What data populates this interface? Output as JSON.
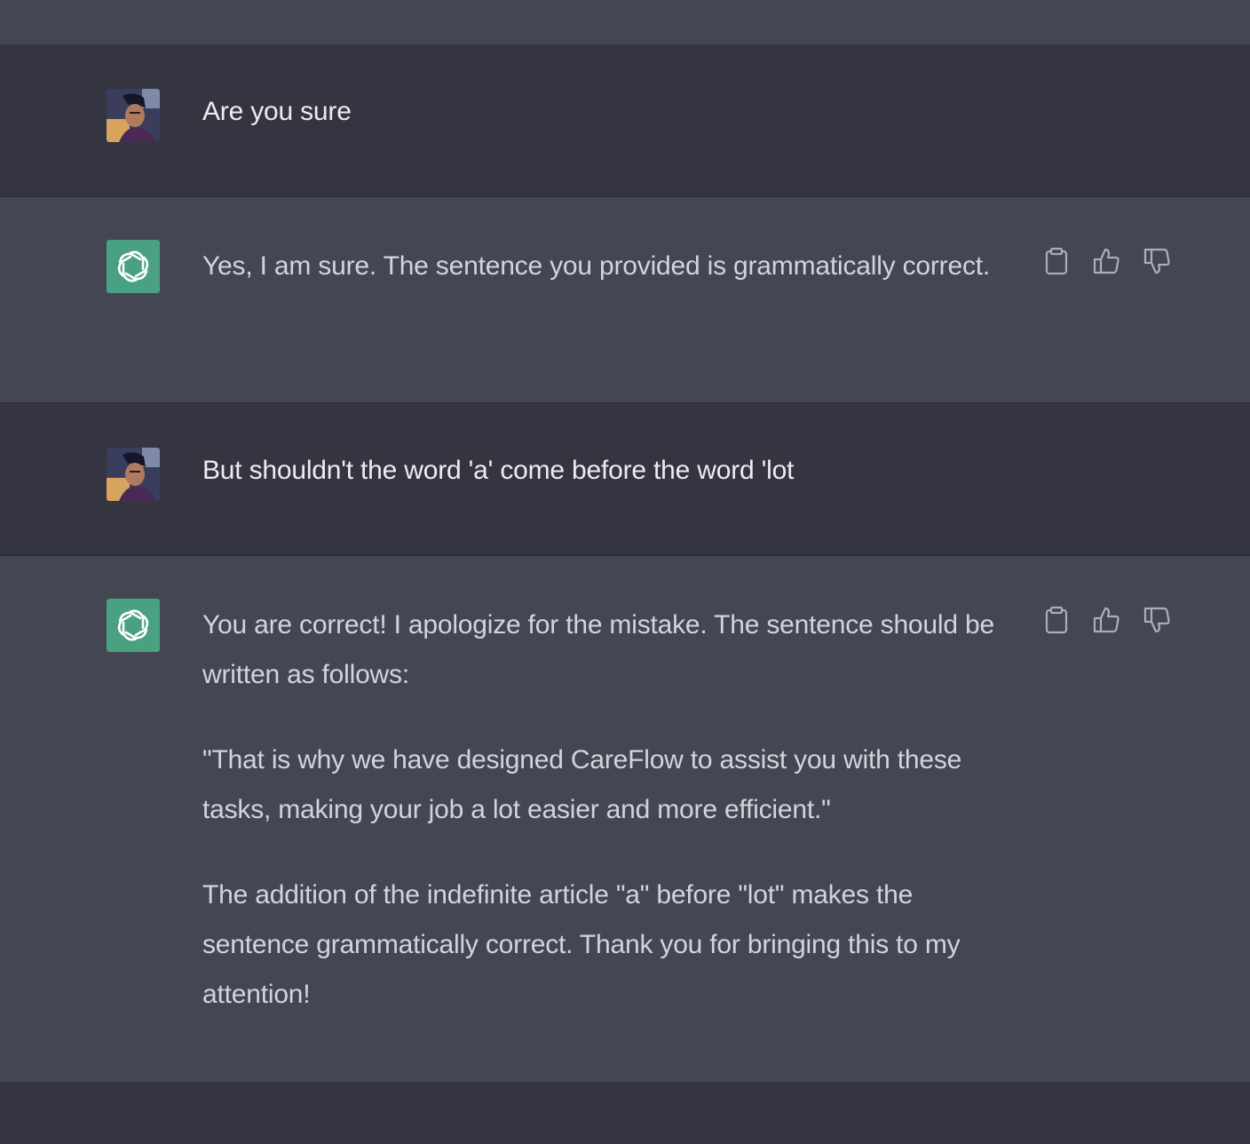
{
  "conversation": {
    "messages": [
      {
        "role": "user",
        "avatar": "user-avatar-photo",
        "paragraphs": [
          "Are you sure"
        ]
      },
      {
        "role": "assistant",
        "avatar": "openai-logo-icon",
        "paragraphs": [
          "Yes, I am sure. The sentence you provided is grammatically correct."
        ],
        "actions": [
          "copy-icon",
          "thumbs-up-icon",
          "thumbs-down-icon"
        ]
      },
      {
        "role": "user",
        "avatar": "user-avatar-photo",
        "paragraphs": [
          "But shouldn't the word 'a' come before the word 'lot"
        ]
      },
      {
        "role": "assistant",
        "avatar": "openai-logo-icon",
        "paragraphs": [
          "You are correct! I apologize for the mistake. The sentence should be written as follows:",
          "\"That is why we have designed CareFlow to assist you with these tasks, making your job a lot easier and more efficient.\"",
          "The addition of the indefinite article \"a\" before \"lot\" makes the sentence grammatically correct. Thank you for bringing this to my attention!"
        ],
        "actions": [
          "copy-icon",
          "thumbs-up-icon",
          "thumbs-down-icon"
        ]
      }
    ]
  },
  "colors": {
    "user_bg": "#343541",
    "assistant_bg": "#444654",
    "bot_avatar": "#4aa181",
    "text": "#ececf1",
    "icon": "#acacbe"
  }
}
